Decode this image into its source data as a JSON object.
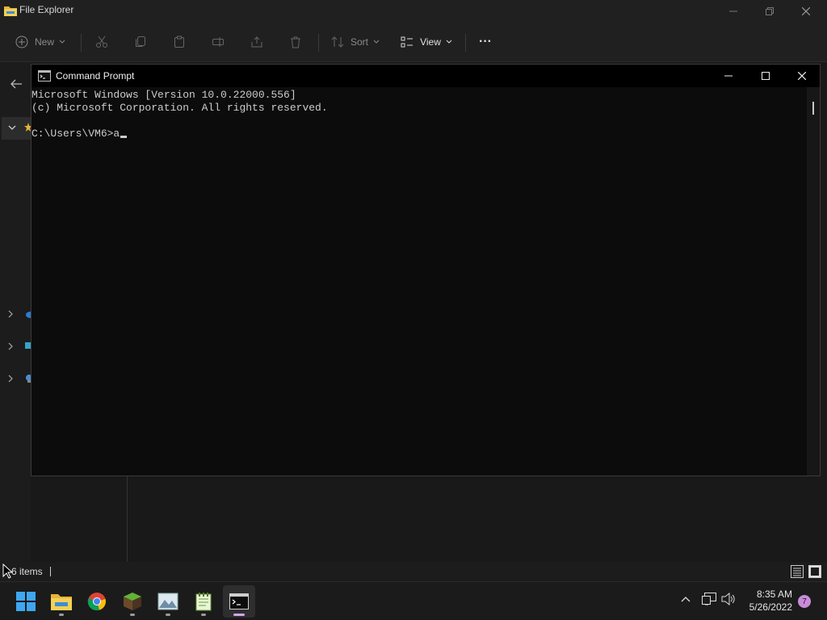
{
  "file_explorer": {
    "title": "File Explorer",
    "toolbar": {
      "new_label": "New",
      "sort_label": "Sort",
      "view_label": "View",
      "more_label": "···"
    },
    "status": {
      "items_count": "6 items"
    }
  },
  "cmd": {
    "title": "Command Prompt",
    "lines": [
      "Microsoft Windows [Version 10.0.22000.556]",
      "(c) Microsoft Corporation. All rights reserved.",
      ""
    ],
    "prompt": "C:\\Users\\VM6>",
    "input": "a"
  },
  "taskbar": {
    "apps": [
      "start",
      "file-explorer",
      "chrome",
      "minecraft",
      "photos",
      "notepad",
      "command-prompt"
    ],
    "time": "8:35 AM",
    "date": "5/26/2022",
    "notification_count": "7"
  },
  "colors": {
    "accent_indicator": "#d6a4f0",
    "notification_badge": "#c98bd9"
  }
}
